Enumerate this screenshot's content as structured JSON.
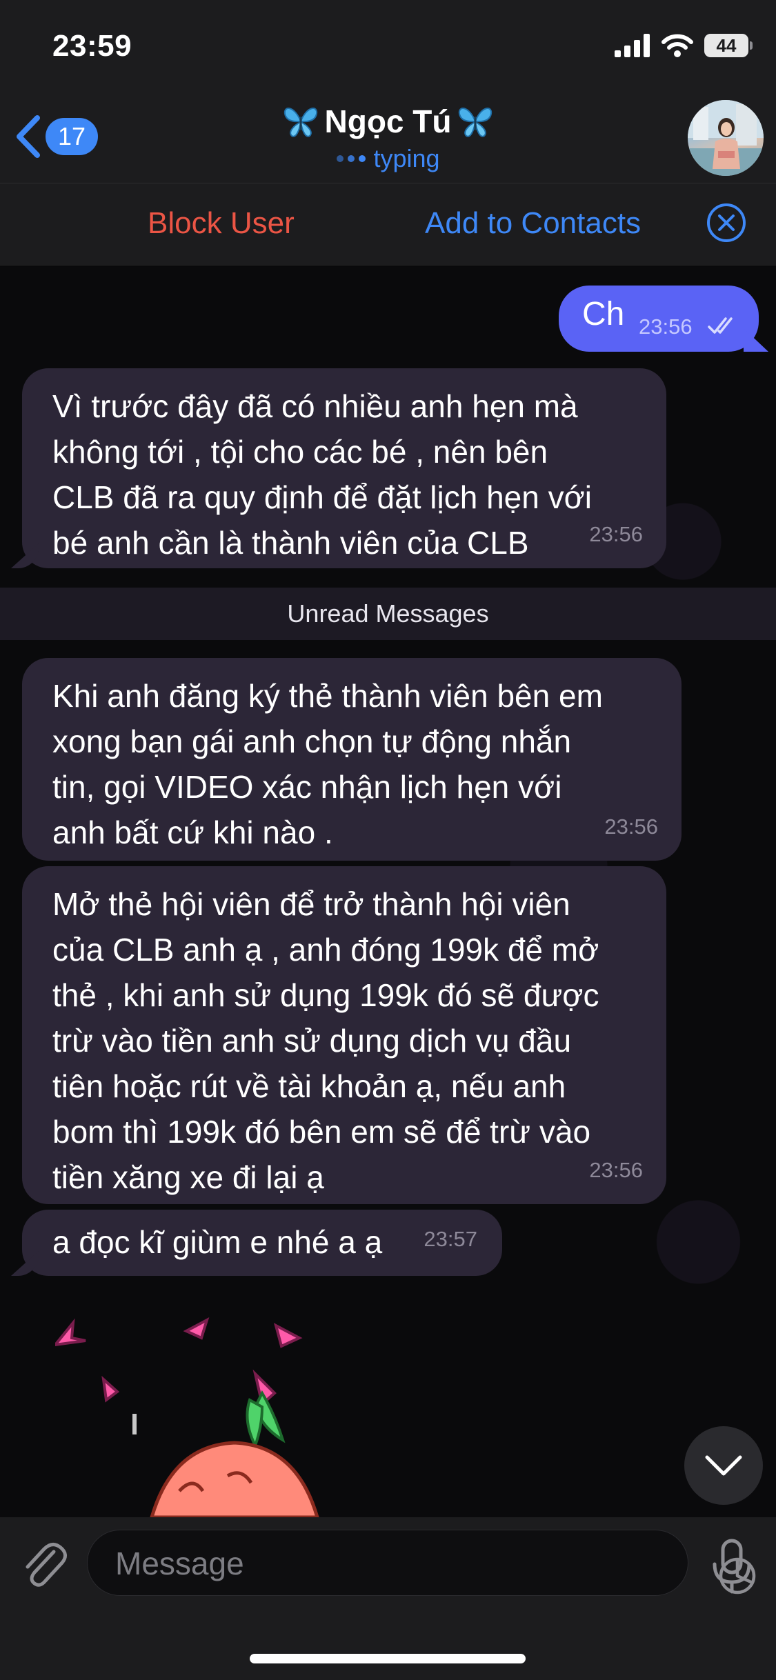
{
  "status_bar": {
    "time": "23:59",
    "battery": "44"
  },
  "header": {
    "back_count": "17",
    "contact_name": "Ngọc Tú",
    "status": "typing"
  },
  "action_bar": {
    "block_label": "Block User",
    "add_label": "Add to Contacts"
  },
  "messages": {
    "outgoing": {
      "text": "Ch",
      "time": "23:56",
      "status": "read"
    },
    "m1": {
      "lines": [
        "Vì trước đây đã có nhiều anh hẹn mà",
        "không tới , tội cho các bé , nên bên",
        "CLB đã ra quy định để đặt lịch hẹn với",
        "bé anh cần là thành viên của CLB"
      ],
      "time": "23:56"
    },
    "unread_label": "Unread Messages",
    "m2": {
      "lines": [
        "Khi anh đăng ký thẻ thành viên bên em",
        "xong bạn gái anh chọn tự động nhắn",
        "tin, gọi VIDEO  xác  nhận  lịch hẹn với",
        "anh bất cứ khi nào ."
      ],
      "time": "23:56"
    },
    "m3": {
      "lines": [
        "Mở thẻ hội viên để trở thành hội viên",
        "của CLB anh ạ , anh đóng 199k để mở",
        "thẻ , khi anh sử dụng 199k đó sẽ được",
        "trừ vào tiền anh sử dụng dịch vụ đầu",
        "tiên hoặc rút về tài khoản ạ, nếu anh",
        "bom thì 199k đó bên em sẽ để trừ vào",
        "tiền xăng xe đi lại ạ"
      ],
      "time": "23:56"
    },
    "m4": {
      "text": "a đọc kĩ giùm e nhé a ạ",
      "time": "23:57"
    }
  },
  "composer": {
    "placeholder": "Message"
  },
  "colors": {
    "accent": "#3e88f7",
    "danger": "#eb5545",
    "outgoing_bubble": "#5a63f5",
    "incoming_bubble": "#2c2637"
  },
  "icons": [
    "back-chevron-icon",
    "butterfly-icon",
    "typing-dots-icon",
    "close-circle-icon",
    "double-check-icon",
    "paperclip-icon",
    "sticker-icon",
    "microphone-icon",
    "chevron-down-icon",
    "signal-icon",
    "wifi-icon",
    "battery-icon"
  ]
}
